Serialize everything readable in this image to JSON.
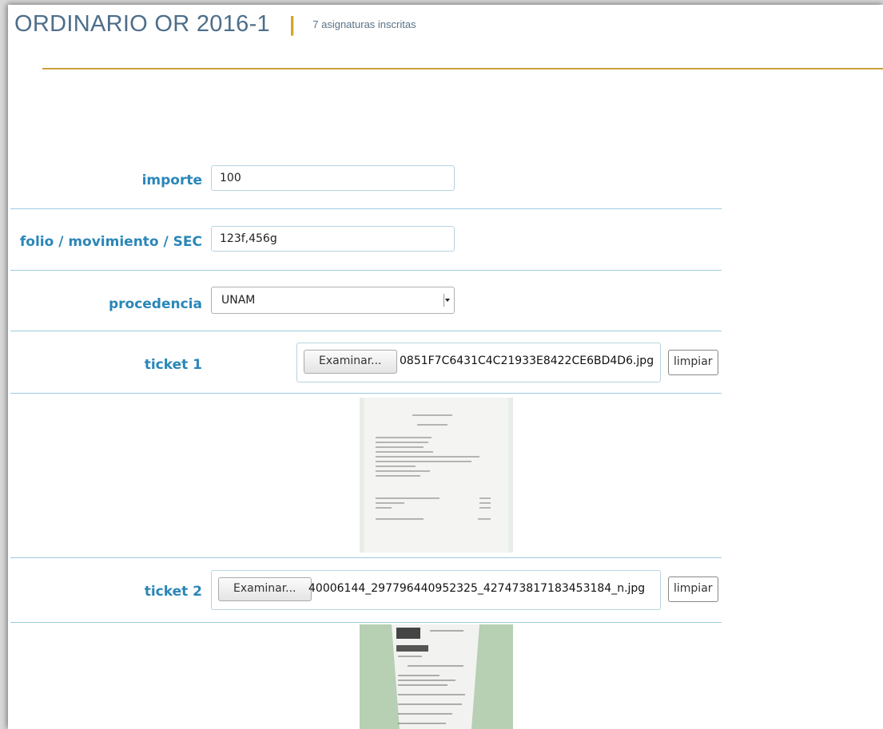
{
  "header": {
    "title": "ORDINARIO OR 2016-1",
    "separator": "|",
    "subtitle": "7 asignaturas inscritas"
  },
  "form": {
    "importe": {
      "label": "importe",
      "value": "100"
    },
    "folio": {
      "label": "folio / movimiento / SEC",
      "value": "123f,456g"
    },
    "procedencia": {
      "label": "procedencia",
      "selected": "UNAM"
    },
    "ticket1": {
      "label": "ticket 1",
      "browse": "Examinar...",
      "filename": "0851F7C6431C4C21933E8422CE6BD4D6.jpg",
      "clear": "limpiar"
    },
    "ticket2": {
      "label": "ticket 2",
      "browse": "Examinar...",
      "filename": "40006144_297796440952325_427473817183453184_n.jpg",
      "clear": "limpiar"
    }
  },
  "colors": {
    "title": "#4d6e8a",
    "label": "#2a86b8",
    "gold": "#c9a23e",
    "divider": "#9ccbe0"
  }
}
